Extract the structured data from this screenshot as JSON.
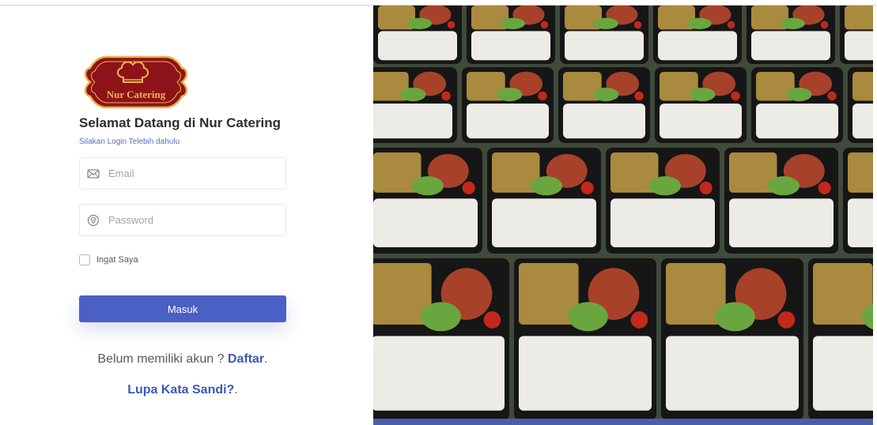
{
  "brand": {
    "logo_text": "Nur Catering",
    "color_maroon": "#8e1319",
    "color_gold": "#e8b64c"
  },
  "login": {
    "title": "Selamat Datang di Nur Catering",
    "subtitle": "Silakan Login Telebih dahulu",
    "email": {
      "placeholder": "Email",
      "value": "",
      "icon": "mail-icon"
    },
    "password": {
      "placeholder": "Password",
      "value": "",
      "icon": "shield-icon"
    },
    "remember_label": "Ingat Saya",
    "remember_checked": false,
    "submit_label": "Masuk",
    "register_prompt": "Belum memiliki akun ? ",
    "register_link": "Daftar",
    "register_suffix": ".",
    "forgot_link": "Lupa Kata Sandi?",
    "forgot_suffix": ".",
    "accent_color": "#4b60c4"
  },
  "hero": {
    "icon": "catering-food-photo"
  }
}
